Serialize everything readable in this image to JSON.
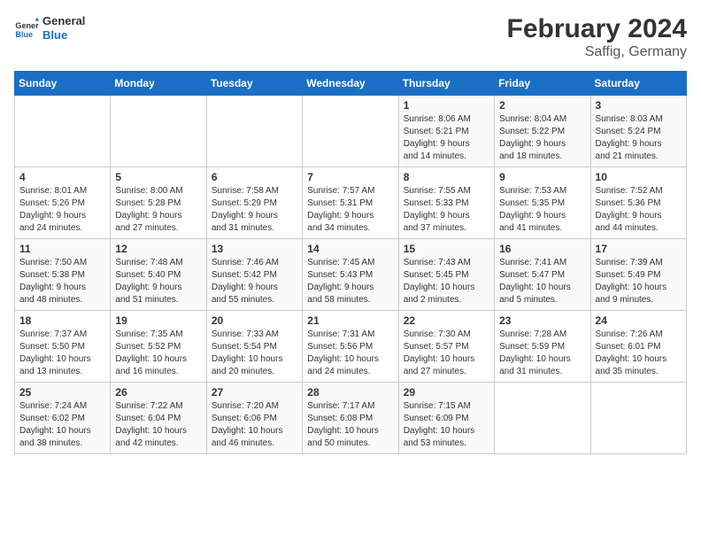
{
  "logo": {
    "text_general": "General",
    "text_blue": "Blue"
  },
  "title": "February 2024",
  "subtitle": "Saffig, Germany",
  "days_of_week": [
    "Sunday",
    "Monday",
    "Tuesday",
    "Wednesday",
    "Thursday",
    "Friday",
    "Saturday"
  ],
  "weeks": [
    [
      {
        "day": "",
        "detail": ""
      },
      {
        "day": "",
        "detail": ""
      },
      {
        "day": "",
        "detail": ""
      },
      {
        "day": "",
        "detail": ""
      },
      {
        "day": "1",
        "detail": "Sunrise: 8:06 AM\nSunset: 5:21 PM\nDaylight: 9 hours\nand 14 minutes."
      },
      {
        "day": "2",
        "detail": "Sunrise: 8:04 AM\nSunset: 5:22 PM\nDaylight: 9 hours\nand 18 minutes."
      },
      {
        "day": "3",
        "detail": "Sunrise: 8:03 AM\nSunset: 5:24 PM\nDaylight: 9 hours\nand 21 minutes."
      }
    ],
    [
      {
        "day": "4",
        "detail": "Sunrise: 8:01 AM\nSunset: 5:26 PM\nDaylight: 9 hours\nand 24 minutes."
      },
      {
        "day": "5",
        "detail": "Sunrise: 8:00 AM\nSunset: 5:28 PM\nDaylight: 9 hours\nand 27 minutes."
      },
      {
        "day": "6",
        "detail": "Sunrise: 7:58 AM\nSunset: 5:29 PM\nDaylight: 9 hours\nand 31 minutes."
      },
      {
        "day": "7",
        "detail": "Sunrise: 7:57 AM\nSunset: 5:31 PM\nDaylight: 9 hours\nand 34 minutes."
      },
      {
        "day": "8",
        "detail": "Sunrise: 7:55 AM\nSunset: 5:33 PM\nDaylight: 9 hours\nand 37 minutes."
      },
      {
        "day": "9",
        "detail": "Sunrise: 7:53 AM\nSunset: 5:35 PM\nDaylight: 9 hours\nand 41 minutes."
      },
      {
        "day": "10",
        "detail": "Sunrise: 7:52 AM\nSunset: 5:36 PM\nDaylight: 9 hours\nand 44 minutes."
      }
    ],
    [
      {
        "day": "11",
        "detail": "Sunrise: 7:50 AM\nSunset: 5:38 PM\nDaylight: 9 hours\nand 48 minutes."
      },
      {
        "day": "12",
        "detail": "Sunrise: 7:48 AM\nSunset: 5:40 PM\nDaylight: 9 hours\nand 51 minutes."
      },
      {
        "day": "13",
        "detail": "Sunrise: 7:46 AM\nSunset: 5:42 PM\nDaylight: 9 hours\nand 55 minutes."
      },
      {
        "day": "14",
        "detail": "Sunrise: 7:45 AM\nSunset: 5:43 PM\nDaylight: 9 hours\nand 58 minutes."
      },
      {
        "day": "15",
        "detail": "Sunrise: 7:43 AM\nSunset: 5:45 PM\nDaylight: 10 hours\nand 2 minutes."
      },
      {
        "day": "16",
        "detail": "Sunrise: 7:41 AM\nSunset: 5:47 PM\nDaylight: 10 hours\nand 5 minutes."
      },
      {
        "day": "17",
        "detail": "Sunrise: 7:39 AM\nSunset: 5:49 PM\nDaylight: 10 hours\nand 9 minutes."
      }
    ],
    [
      {
        "day": "18",
        "detail": "Sunrise: 7:37 AM\nSunset: 5:50 PM\nDaylight: 10 hours\nand 13 minutes."
      },
      {
        "day": "19",
        "detail": "Sunrise: 7:35 AM\nSunset: 5:52 PM\nDaylight: 10 hours\nand 16 minutes."
      },
      {
        "day": "20",
        "detail": "Sunrise: 7:33 AM\nSunset: 5:54 PM\nDaylight: 10 hours\nand 20 minutes."
      },
      {
        "day": "21",
        "detail": "Sunrise: 7:31 AM\nSunset: 5:56 PM\nDaylight: 10 hours\nand 24 minutes."
      },
      {
        "day": "22",
        "detail": "Sunrise: 7:30 AM\nSunset: 5:57 PM\nDaylight: 10 hours\nand 27 minutes."
      },
      {
        "day": "23",
        "detail": "Sunrise: 7:28 AM\nSunset: 5:59 PM\nDaylight: 10 hours\nand 31 minutes."
      },
      {
        "day": "24",
        "detail": "Sunrise: 7:26 AM\nSunset: 6:01 PM\nDaylight: 10 hours\nand 35 minutes."
      }
    ],
    [
      {
        "day": "25",
        "detail": "Sunrise: 7:24 AM\nSunset: 6:02 PM\nDaylight: 10 hours\nand 38 minutes."
      },
      {
        "day": "26",
        "detail": "Sunrise: 7:22 AM\nSunset: 6:04 PM\nDaylight: 10 hours\nand 42 minutes."
      },
      {
        "day": "27",
        "detail": "Sunrise: 7:20 AM\nSunset: 6:06 PM\nDaylight: 10 hours\nand 46 minutes."
      },
      {
        "day": "28",
        "detail": "Sunrise: 7:17 AM\nSunset: 6:08 PM\nDaylight: 10 hours\nand 50 minutes."
      },
      {
        "day": "29",
        "detail": "Sunrise: 7:15 AM\nSunset: 6:09 PM\nDaylight: 10 hours\nand 53 minutes."
      },
      {
        "day": "",
        "detail": ""
      },
      {
        "day": "",
        "detail": ""
      }
    ]
  ]
}
